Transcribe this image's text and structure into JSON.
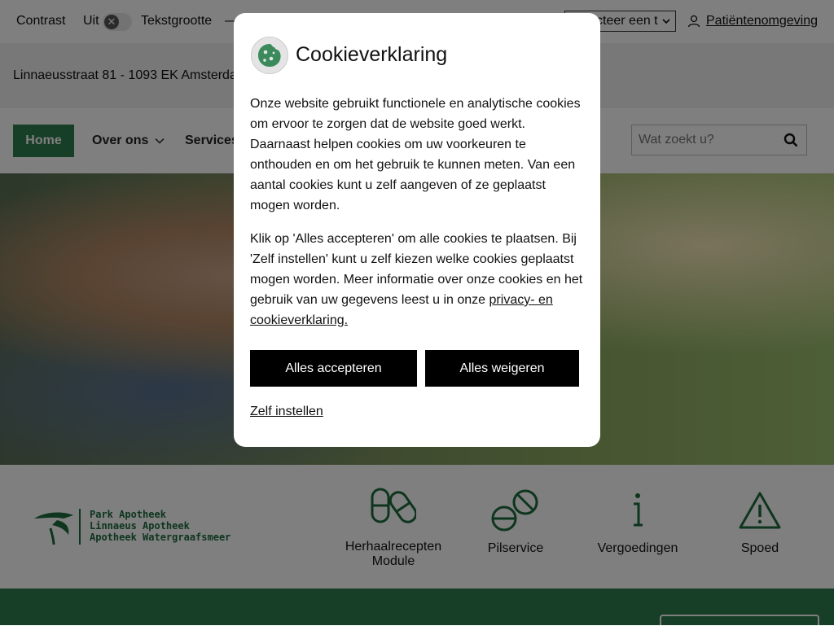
{
  "topbar": {
    "contrast_label": "Contrast",
    "contrast_state": "Uit",
    "toggle_glyph": "✕",
    "textsize_label": "Tekstgrootte",
    "textsize_minus": "—",
    "language_select_value": "Selecteer een t",
    "patient_link": "Patiëntenomgeving"
  },
  "address": {
    "text": "Linnaeusstraat 81 - 1093 EK Amsterdam"
  },
  "nav": {
    "home": "Home",
    "over_ons": "Over ons",
    "services": "Services",
    "search_placeholder": "Wat zoekt u?"
  },
  "logo": {
    "line1": "Park Apotheek",
    "line2": "Linnaeus Apotheek",
    "line3": "Apotheek Watergraafsmeer"
  },
  "services": [
    {
      "label": "Herhaalrecepten Module",
      "icon": "pills-icon"
    },
    {
      "label": "Pilservice",
      "icon": "pill-service-icon"
    },
    {
      "label": "Vergoedingen",
      "icon": "info-icon"
    },
    {
      "label": "Spoed",
      "icon": "warning-icon"
    }
  ],
  "modal": {
    "title": "Cookieverklaring",
    "paragraph1": "Onze website gebruikt functionele en analytische cookies om ervoor te zorgen dat de website goed werkt. Daarnaast helpen cookies om uw voorkeuren te onthouden en om het gebruik te kunnen meten. Van een aantal cookies kunt u zelf aangeven of ze geplaatst mogen worden.",
    "paragraph2_text": "Klik op 'Alles accepteren' om alle cookies te plaatsen. Bij 'Zelf instellen' kunt u zelf kiezen welke cookies geplaatst mogen worden. Meer informatie over onze cookies en het gebruik van uw gegevens leest u in onze ",
    "paragraph2_link": "privacy- en cookieverklaring.",
    "accept_button": "Alles accepteren",
    "reject_button": "Alles weigeren",
    "custom_link": "Zelf instellen"
  },
  "colors": {
    "brand_green": "#2e7d4f",
    "button_black": "#000000",
    "cookie_icon_green": "#3a8a5c"
  }
}
